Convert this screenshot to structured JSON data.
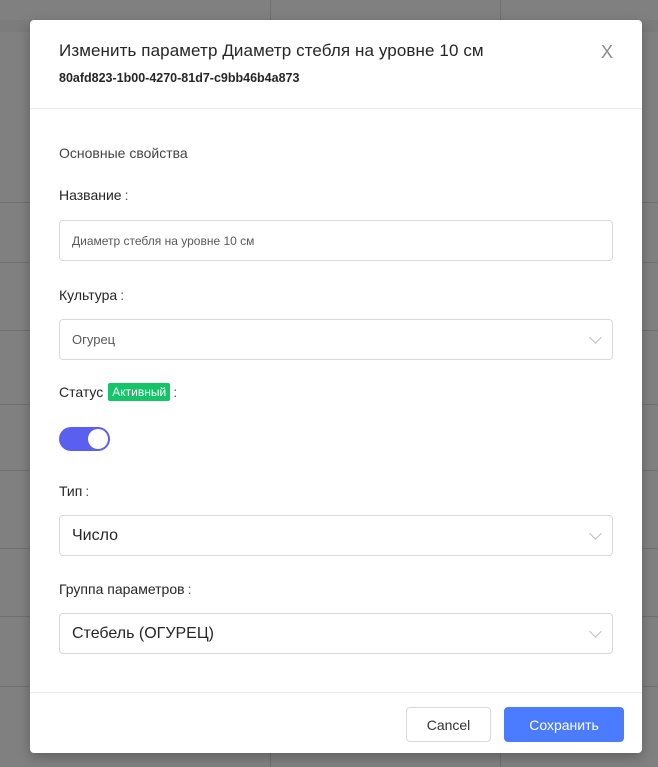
{
  "modal": {
    "title": "Изменить параметр Диаметр стебля на уровне 10 см",
    "subtitle": "80afd823-1b00-4270-81d7-c9bb46b4a873",
    "close_label": "X"
  },
  "form": {
    "section_title": "Основные свойства",
    "name": {
      "label": "Название",
      "colon": ":",
      "value": "Диаметр стебля на уровне 10 см"
    },
    "culture": {
      "label": "Культура",
      "colon": ":",
      "value": "Огурец"
    },
    "status": {
      "label": "Статус",
      "badge": "Активный",
      "colon": ":",
      "enabled": true
    },
    "type": {
      "label": "Тип",
      "colon": ":",
      "value": "Число"
    },
    "group": {
      "label": "Группа параметров",
      "colon": ":",
      "value": "Стебель (ОГУРЕЦ)"
    }
  },
  "footer": {
    "cancel_label": "Cancel",
    "save_label": "Сохранить"
  },
  "colors": {
    "primary": "#4b7cff",
    "toggle": "#5b5ff0",
    "badge": "#13c468"
  }
}
